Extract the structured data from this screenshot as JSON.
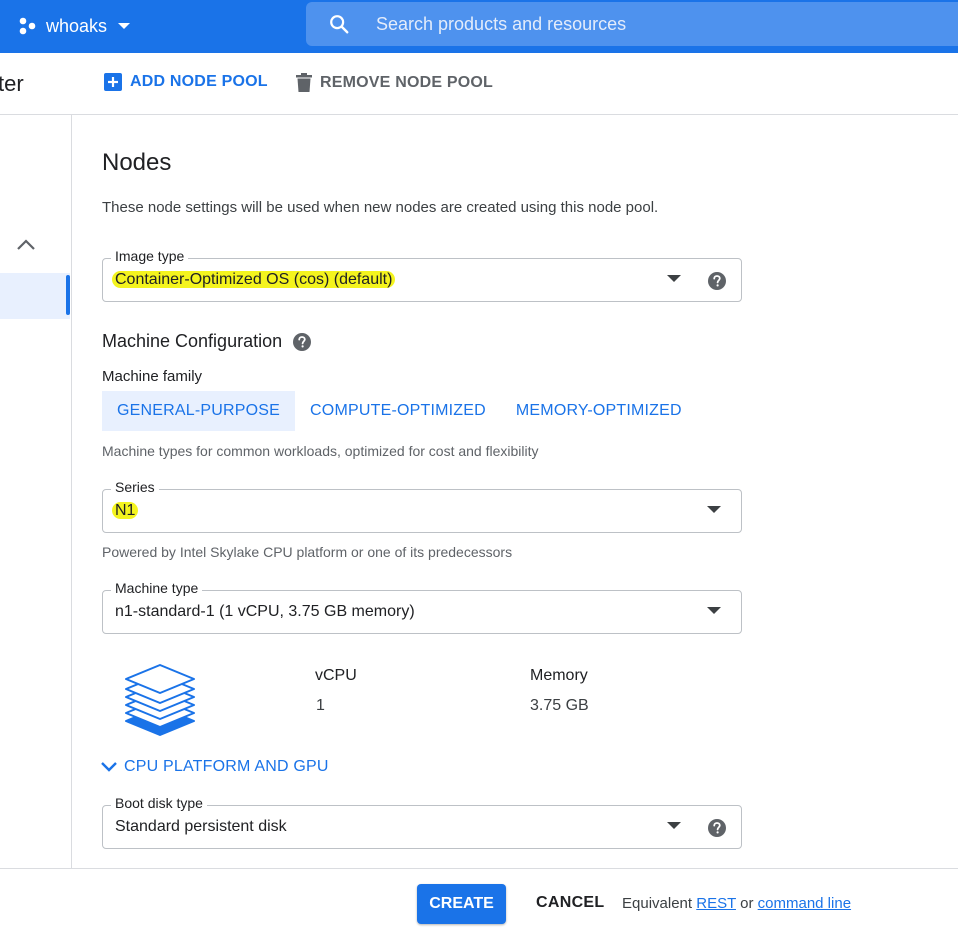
{
  "topbar": {
    "project_name": "whoaks",
    "search_placeholder": "Search products and resources",
    "color": "#1a73e8"
  },
  "toolbar": {
    "page_title_partial": "ter",
    "add_node_pool": "ADD NODE POOL",
    "remove_node_pool": "REMOVE NODE POOL"
  },
  "nodes": {
    "title": "Nodes",
    "description": "These node settings will be used when new nodes are created using this node pool.",
    "image_type": {
      "label": "Image type",
      "value": "Container-Optimized OS (cos) (default)"
    },
    "machine_config": {
      "title": "Machine Configuration",
      "family_label": "Machine family",
      "families": [
        {
          "label": "GENERAL-PURPOSE",
          "selected": true
        },
        {
          "label": "COMPUTE-OPTIMIZED",
          "selected": false
        },
        {
          "label": "MEMORY-OPTIMIZED",
          "selected": false
        }
      ],
      "family_hint": "Machine types for common workloads, optimized for cost and flexibility",
      "series": {
        "label": "Series",
        "value": "N1",
        "hint": "Powered by Intel Skylake CPU platform or one of its predecessors"
      },
      "machine_type": {
        "label": "Machine type",
        "value": "n1-standard-1 (1 vCPU, 3.75 GB memory)"
      },
      "specs": {
        "vcpu_label": "vCPU",
        "vcpu_value": "1",
        "memory_label": "Memory",
        "memory_value": "3.75 GB"
      },
      "cpu_platform_toggle": "CPU PLATFORM AND GPU"
    },
    "boot_disk": {
      "label": "Boot disk type",
      "value": "Standard persistent disk"
    }
  },
  "footer": {
    "create": "CREATE",
    "cancel": "CANCEL",
    "equivalent": "Equivalent",
    "rest": "REST",
    "or": "or",
    "command_line": "command line"
  }
}
